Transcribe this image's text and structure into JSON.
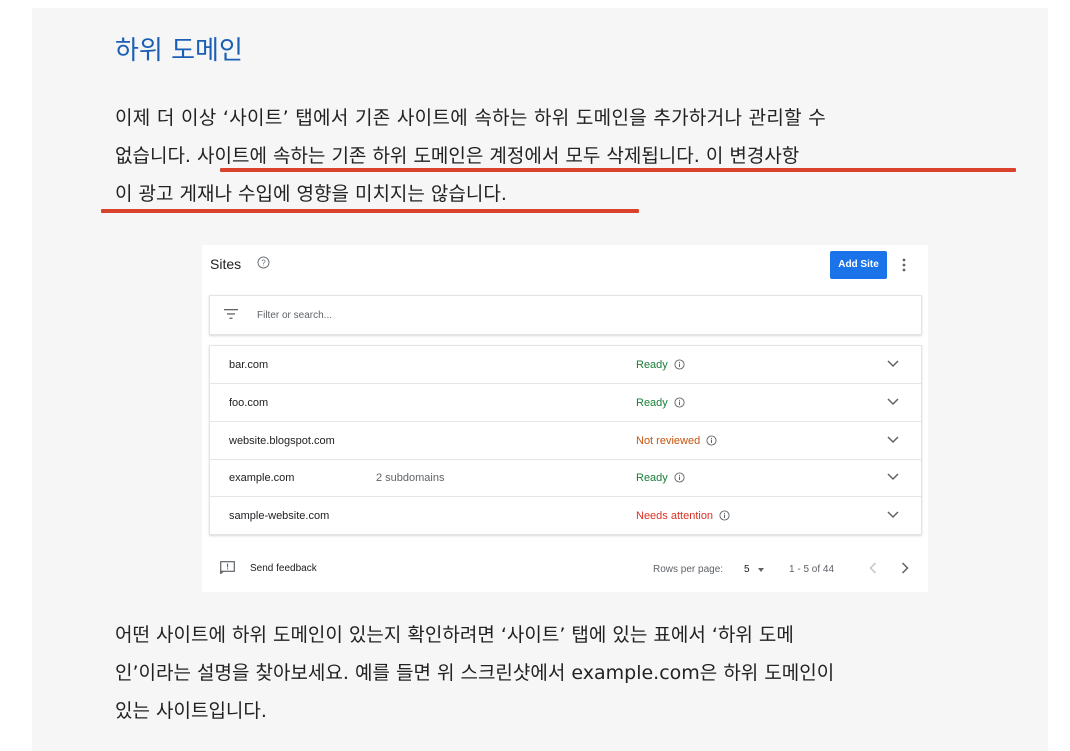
{
  "colors": {
    "heading": "#1a5fb4",
    "underline": "#d9432e",
    "ready": "#188038",
    "not_reviewed": "#c5530b",
    "needs_attention": "#d93025",
    "button": "#1a73e8"
  },
  "article": {
    "heading": "하위 도메인",
    "para1": {
      "line1": "이제 더 이상 ‘사이트’ 탭에서 기존 사이트에 속하는 하위 도메인을 추가하거나 관리할 수",
      "line2_plain": "없습니다. ",
      "line2_emph": "사이트에 속하는 기존 하위 도메인은 계정에서 모두 삭제됩니다. 이 변경사항",
      "line3_emph": "이 광고 게재나 수입에 영향을 미치지는 않습니다."
    },
    "para2": {
      "line1": "어떤 사이트에 하위 도메인이 있는지 확인하려면 ‘사이트’ 탭에 있는 표에서 ‘하위 도메",
      "line2": "인’이라는 설명을 찾아보세요. 예를 들면 위 스크린샷에서 example.com은 하위 도메인이",
      "line3": "있는 사이트입니다."
    }
  },
  "screenshot": {
    "title": "Sites",
    "add_site_label": "Add Site",
    "filter_placeholder": "Filter or search...",
    "rows": [
      {
        "site": "bar.com",
        "sub": "",
        "status": "Ready",
        "status_color": "#188038"
      },
      {
        "site": "foo.com",
        "sub": "",
        "status": "Ready",
        "status_color": "#188038"
      },
      {
        "site": "website.blogspot.com",
        "sub": "",
        "status": "Not reviewed",
        "status_color": "#c5530b"
      },
      {
        "site": "example.com",
        "sub": "2 subdomains",
        "status": "Ready",
        "status_color": "#188038"
      },
      {
        "site": "sample-website.com",
        "sub": "",
        "status": "Needs attention",
        "status_color": "#d93025"
      }
    ],
    "footer": {
      "feedback": "Send feedback",
      "rows_per_page_label": "Rows per page:",
      "rows_per_page_value": "5",
      "range": "1 - 5 of 44"
    }
  }
}
